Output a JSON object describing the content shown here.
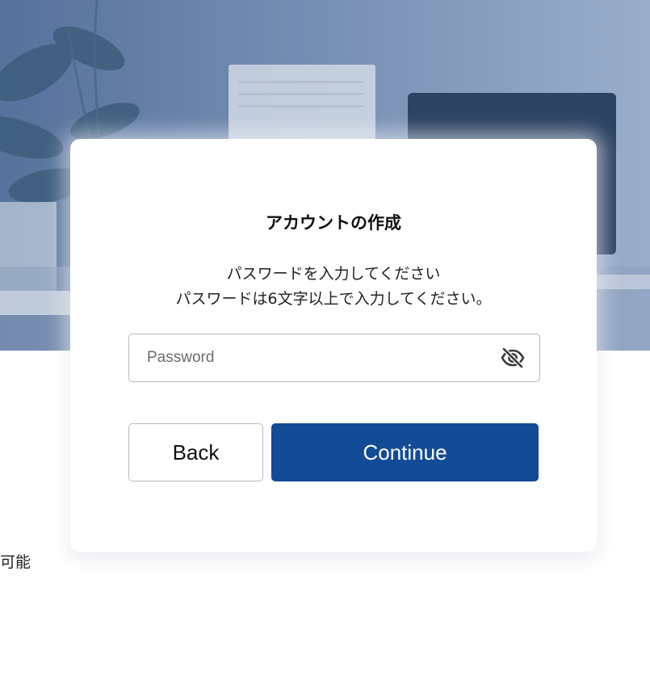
{
  "page": {
    "under_text": "可能"
  },
  "dialog": {
    "title": "アカウントの作成",
    "description_line1": "パスワードを入力してください",
    "description_line2": "パスワードは6文字以上で入力してください。",
    "password_placeholder": "Password",
    "password_value": "",
    "visibility_icon": "eye-off-icon",
    "back_label": "Back",
    "continue_label": "Continue"
  },
  "colors": {
    "primary": "#134b96",
    "border": "#b7b9bd"
  }
}
